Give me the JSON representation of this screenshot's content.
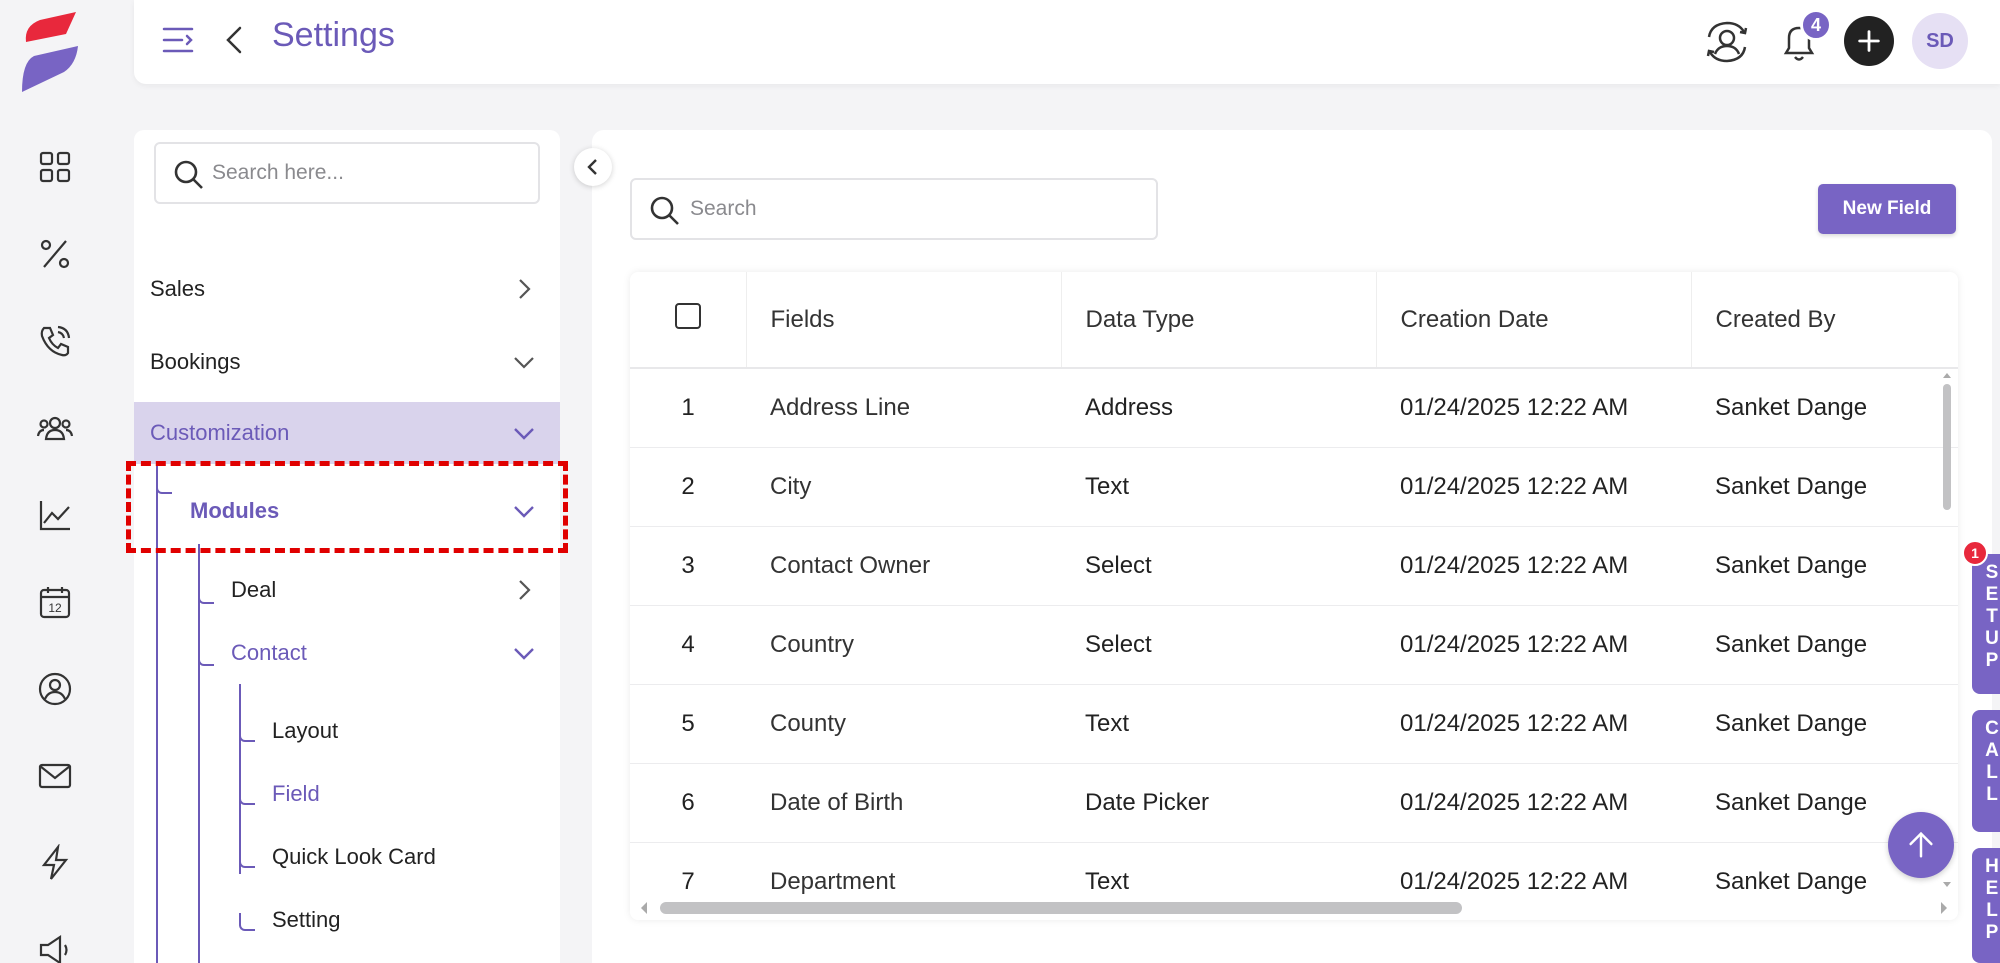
{
  "header": {
    "title": "Settings",
    "notifications_count": "4",
    "avatar_initials": "SD"
  },
  "rail": {
    "icons": [
      "dashboard-icon",
      "percent-icon",
      "phone-icon",
      "contacts-icon",
      "chart-icon",
      "calendar-icon",
      "user-circle-icon",
      "mail-icon",
      "lightning-icon",
      "megaphone-icon"
    ],
    "calendar_day": "12"
  },
  "nav": {
    "search_placeholder": "Search here...",
    "items": {
      "sales": "Sales",
      "bookings": "Bookings",
      "customization": "Customization",
      "modules": "Modules",
      "deal": "Deal",
      "contact": "Contact",
      "layout": "Layout",
      "field": "Field",
      "quick_look_card": "Quick Look Card",
      "setting": "Setting"
    }
  },
  "main": {
    "search_placeholder": "Search",
    "new_field_label": "New Field",
    "columns": [
      "Fields",
      "Data Type",
      "Creation Date",
      "Created By"
    ],
    "rows": [
      {
        "num": "1",
        "field": "Address Line",
        "type": "Address",
        "date": "01/24/2025 12:22 AM",
        "by": "Sanket Dange"
      },
      {
        "num": "2",
        "field": "City",
        "type": "Text",
        "date": "01/24/2025 12:22 AM",
        "by": "Sanket Dange"
      },
      {
        "num": "3",
        "field": "Contact Owner",
        "type": "Select",
        "date": "01/24/2025 12:22 AM",
        "by": "Sanket Dange"
      },
      {
        "num": "4",
        "field": "Country",
        "type": "Select",
        "date": "01/24/2025 12:22 AM",
        "by": "Sanket Dange"
      },
      {
        "num": "5",
        "field": "County",
        "type": "Text",
        "date": "01/24/2025 12:22 AM",
        "by": "Sanket Dange"
      },
      {
        "num": "6",
        "field": "Date of Birth",
        "type": "Date Picker",
        "date": "01/24/2025 12:22 AM",
        "by": "Sanket Dange"
      },
      {
        "num": "7",
        "field": "Department",
        "type": "Text",
        "date": "01/24/2025 12:22 AM",
        "by": "Sanket Dange"
      }
    ]
  },
  "side_tabs": [
    {
      "letters": [
        "S",
        "E",
        "T",
        "U",
        "P"
      ],
      "badge": "1"
    },
    {
      "letters": [
        "C",
        "A",
        "L",
        "L"
      ]
    },
    {
      "letters": [
        "H",
        "E",
        "L",
        "P"
      ]
    }
  ],
  "colors": {
    "accent": "#7864c4",
    "accent_text": "#6b5ab8",
    "active_nav_bg": "#d9d3ec",
    "highlight_border": "#e00000"
  }
}
